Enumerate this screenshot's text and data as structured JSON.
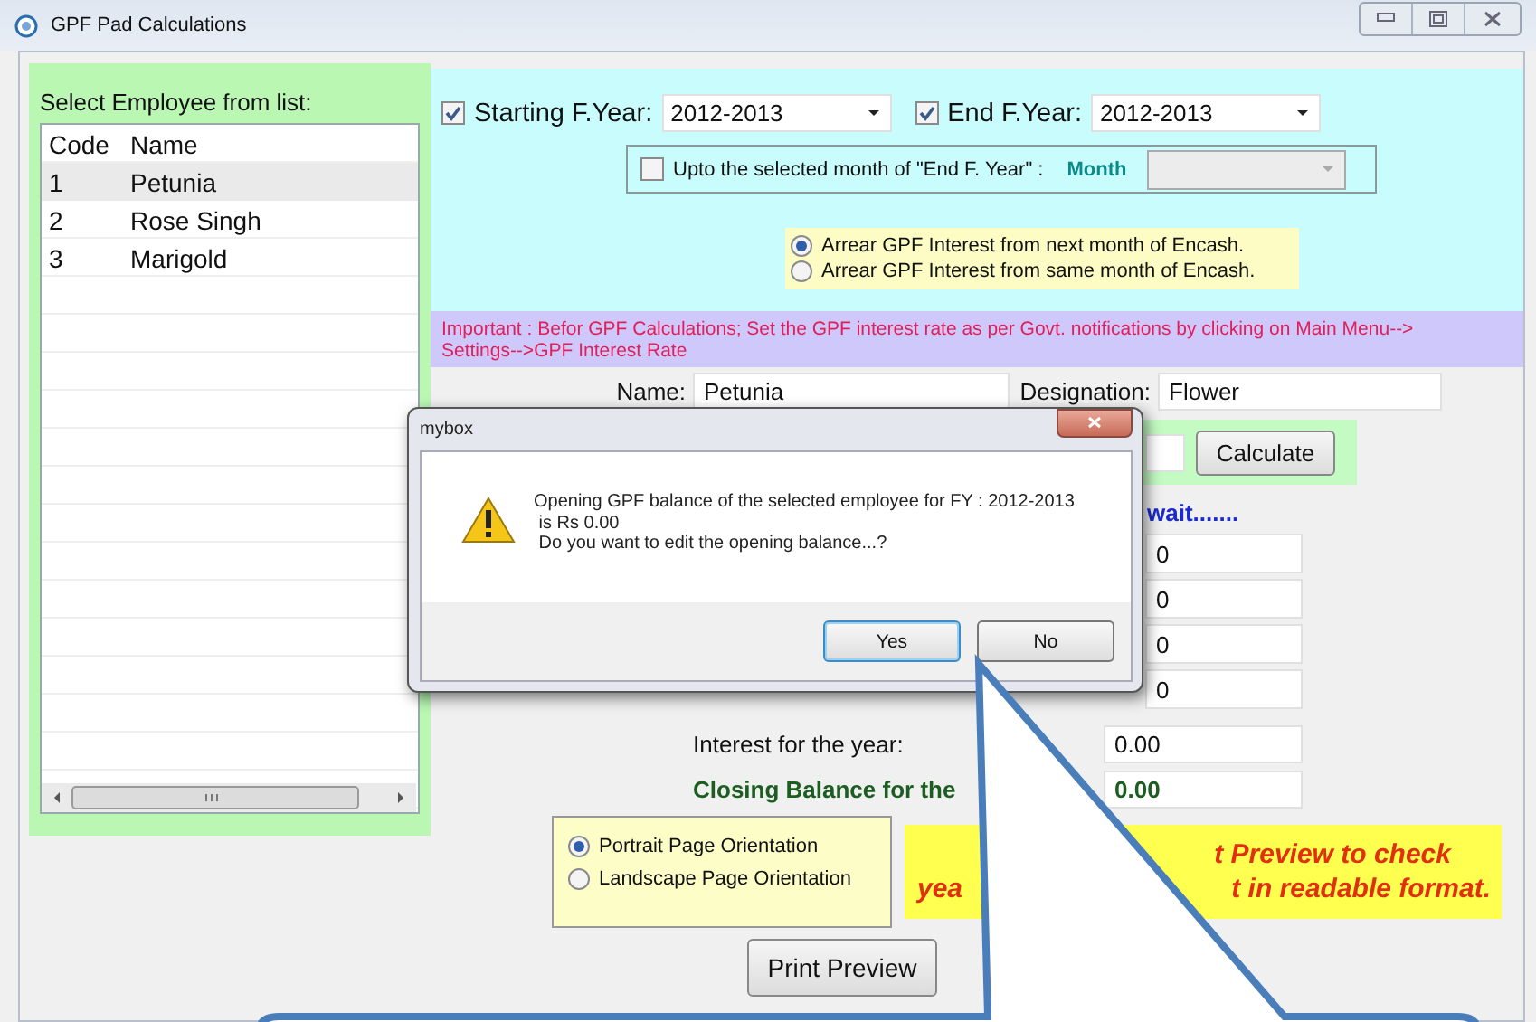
{
  "window": {
    "title": "GPF Pad Calculations"
  },
  "employee_panel": {
    "label": "Select Employee from list:",
    "columns": [
      "Code",
      "Name"
    ],
    "rows": [
      {
        "code": "1",
        "name": "Petunia",
        "selected": true
      },
      {
        "code": "2",
        "name": "Rose Singh",
        "selected": false
      },
      {
        "code": "3",
        "name": "Marigold",
        "selected": false
      }
    ]
  },
  "year_range": [
    {
      "label": "Starting F.Year:",
      "checked": true,
      "value": "2012-2013"
    },
    {
      "label": "End F.Year:",
      "checked": true,
      "value": "2012-2013"
    }
  ],
  "month_filter": {
    "label": "Upto the selected month of  \"End F. Year\" :",
    "checked": false,
    "month_label": "Month",
    "disabled": true
  },
  "arrear_options": [
    {
      "label": "Arrear GPF Interest from next month of Encash.",
      "selected": true
    },
    {
      "label": "Arrear GPF Interest from same month of Encash.",
      "selected": false
    }
  ],
  "notice": "Important : Befor GPF Calculations; Set the GPF interest rate as per Govt. notifications by clicking on Main Menu--> Settings-->GPF Interest Rate",
  "name_field": {
    "label": "Name:",
    "value": "Petunia"
  },
  "designation_field": {
    "label": "Designation:",
    "value": "Flower"
  },
  "calculate_button": "Calculate",
  "status_text": "wait.......",
  "partial_fields": [
    "0",
    "0",
    "0",
    "0"
  ],
  "interest": {
    "label": "Interest for the year:",
    "value": "0.00"
  },
  "closing": {
    "label": "Closing Balance for the",
    "value": "0.00"
  },
  "orientation_options": [
    {
      "label": "Portrait Page Orientation",
      "selected": true
    },
    {
      "label": "Landscape Page Orientation",
      "selected": false
    }
  ],
  "note_fragments": {
    "line_1_right": "t Preview to check",
    "line_2_left": "yea",
    "line_2_right": "t in readable format."
  },
  "print_preview_button": "Print Preview",
  "dialog": {
    "title": "mybox",
    "message_lines": [
      "Opening GPF balance of the selected employee for FY : 2012-2013",
      "is Rs 0.00",
      "Do you want to edit the opening balance...?"
    ],
    "buttons": [
      {
        "label": "Yes",
        "selected": true
      },
      {
        "label": "No",
        "selected": false
      }
    ]
  }
}
